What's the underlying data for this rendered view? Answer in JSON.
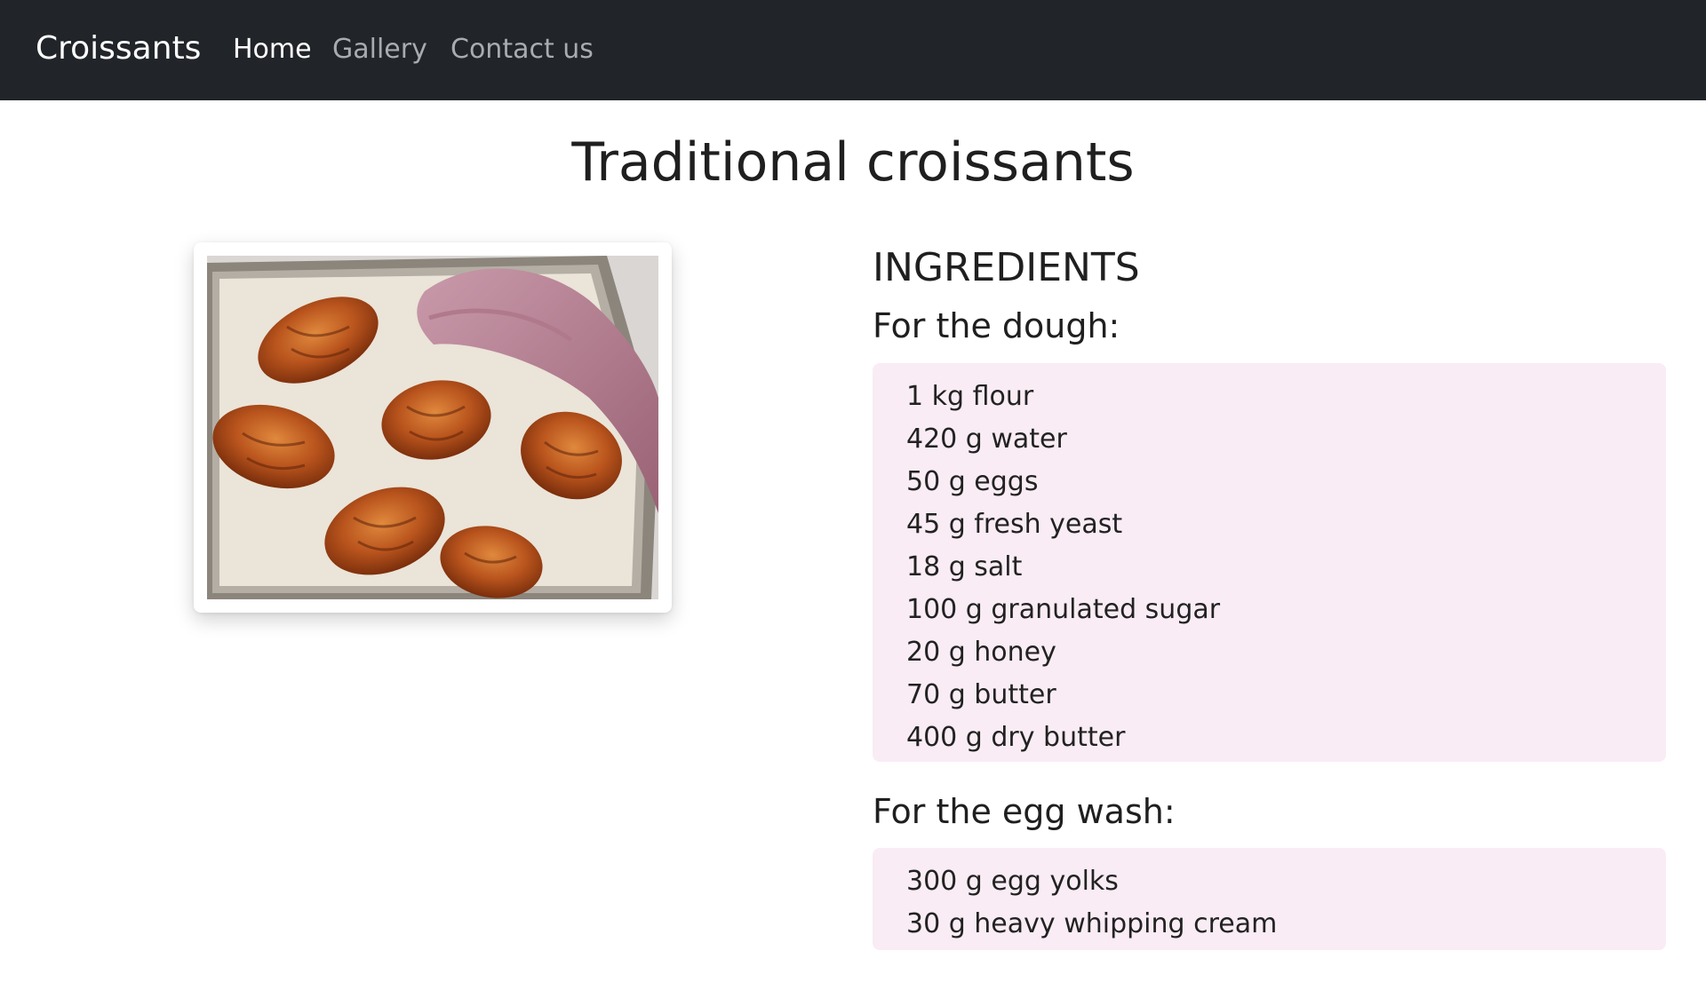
{
  "navbar": {
    "brand": "Croissants",
    "links": [
      {
        "label": "Home",
        "active": true
      },
      {
        "label": "Gallery",
        "active": false
      },
      {
        "label": "Contact us",
        "active": false
      }
    ]
  },
  "main": {
    "title": "Traditional croissants",
    "image_subject": "baked croissants on a baking tray with a pink napkin",
    "ingredients": {
      "heading": "INGREDIENTS",
      "dough": {
        "heading": "For the dough:",
        "items": [
          "1 kg flour",
          "420 g water",
          "50 g eggs",
          "45 g fresh yeast",
          "18 g salt",
          "100 g granulated sugar",
          "20 g honey",
          "70 g butter",
          "400 g dry butter"
        ]
      },
      "egg_wash": {
        "heading": "For the egg wash:",
        "items": [
          "300 g egg yolks",
          "30 g heavy whipping cream"
        ]
      }
    }
  },
  "colors": {
    "navbar_bg": "#212529",
    "nav_active": "#ffffff",
    "nav_inactive": "#a8abaf",
    "list_bg": "#f9ecf4"
  }
}
